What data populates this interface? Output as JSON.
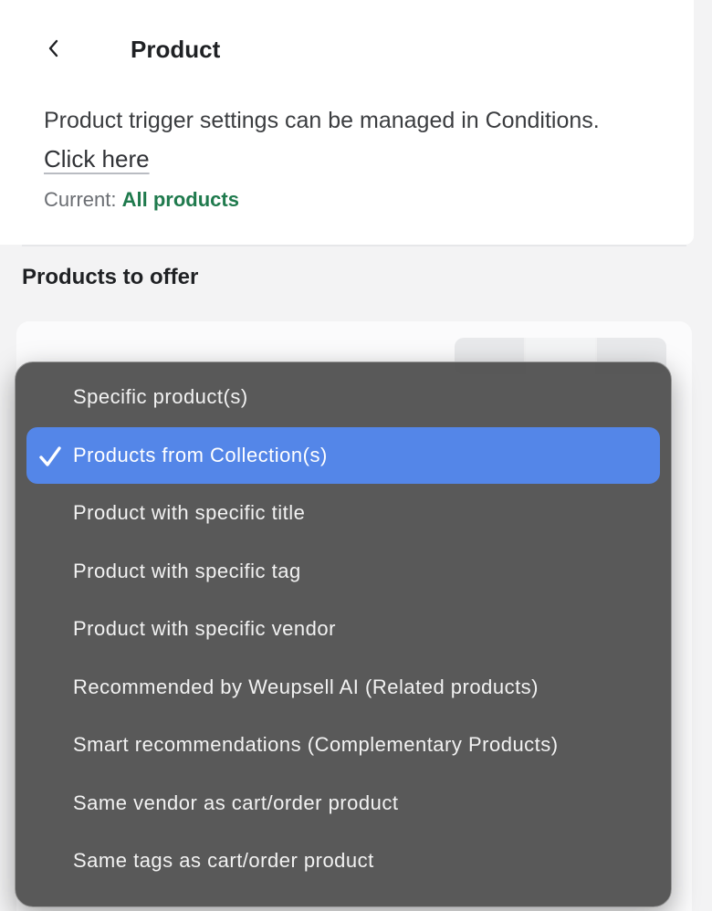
{
  "header": {
    "title": "Product"
  },
  "trigger": {
    "info_text": "Product trigger settings can be managed in Conditions.",
    "link_text": "Click here",
    "current_label": "Current:",
    "current_value": "All products"
  },
  "offer": {
    "section_title": "Products to offer"
  },
  "menu": {
    "selected_index": 1,
    "items": [
      {
        "label": "Specific product(s)"
      },
      {
        "label": "Products from Collection(s)"
      },
      {
        "label": "Product with specific title"
      },
      {
        "label": "Product with specific tag"
      },
      {
        "label": "Product with specific vendor"
      },
      {
        "label": "Recommended by Weupsell AI (Related products)"
      },
      {
        "label": "Smart recommendations (Complementary Products)"
      },
      {
        "label": "Same vendor as cart/order product"
      },
      {
        "label": "Same tags as cart/order product"
      }
    ]
  },
  "colors": {
    "accent": "#5486e8",
    "current_value": "#1f7a4d",
    "menu_background": "#4c4c4c"
  }
}
